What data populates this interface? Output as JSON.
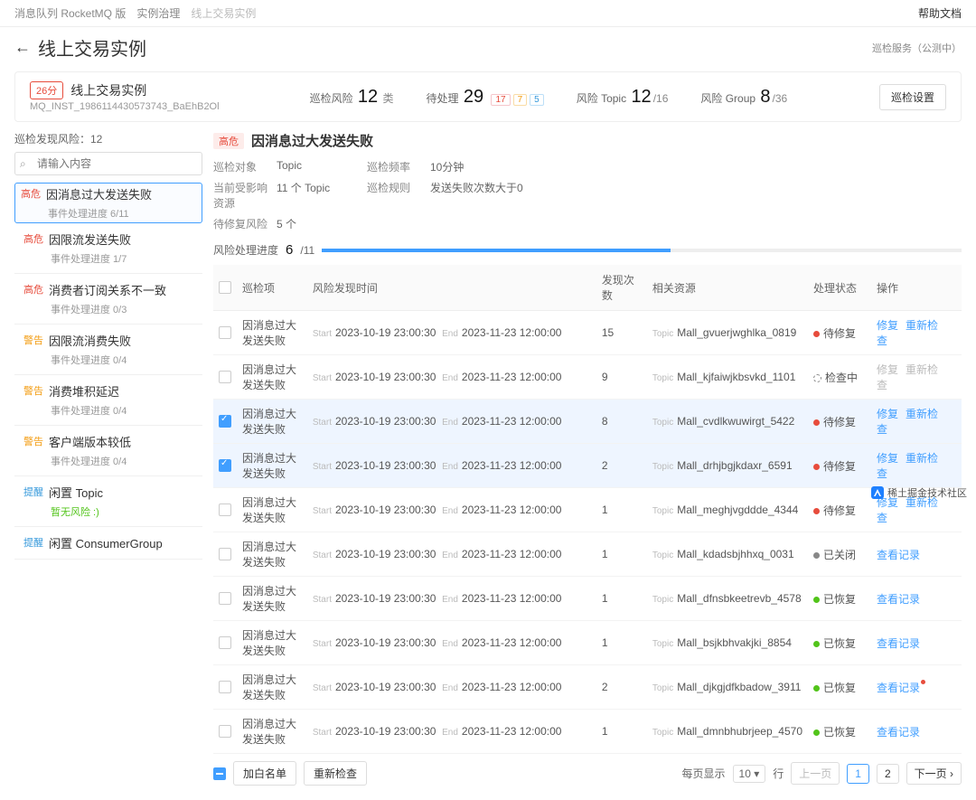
{
  "breadcrumb": {
    "a": "消息队列 RocketMQ 版",
    "b": "实例治理",
    "c": "线上交易实例"
  },
  "help": "帮助文档",
  "title": "线上交易实例",
  "subtag": "巡检服务（公测中）",
  "inst": {
    "score": "26分",
    "name": "线上交易实例",
    "id": "MQ_INST_1986114430573743_BaEhB2Ol"
  },
  "stats": {
    "risk_label": "巡检风险",
    "risk_n": "12",
    "risk_u": "类",
    "pend_label": "待处理",
    "pend_n": "29",
    "t1": "17",
    "t2": "7",
    "t3": "5",
    "topic_label": "风险 Topic",
    "topic_a": "12",
    "topic_b": "/16",
    "group_label": "风险 Group",
    "group_a": "8",
    "group_b": "/36",
    "btn": "巡检设置"
  },
  "left": {
    "cap": "巡检发现风险：12",
    "ph": "请输入内容",
    "items": [
      {
        "lvl": "高危",
        "cls": "high",
        "title": "因消息过大发送失败",
        "sub": "事件处理进度 6/11",
        "sel": true
      },
      {
        "lvl": "高危",
        "cls": "high",
        "title": "因限流发送失败",
        "sub": "事件处理进度 1/7"
      },
      {
        "lvl": "高危",
        "cls": "high",
        "title": "消费者订阅关系不一致",
        "sub": "事件处理进度 0/3"
      },
      {
        "lvl": "警告",
        "cls": "warn",
        "title": "因限流消费失败",
        "sub": "事件处理进度 0/4"
      },
      {
        "lvl": "警告",
        "cls": "warn",
        "title": "消费堆积延迟",
        "sub": "事件处理进度 0/4"
      },
      {
        "lvl": "警告",
        "cls": "warn",
        "title": "客户端版本较低",
        "sub": "事件处理进度 0/4"
      },
      {
        "lvl": "提醒",
        "cls": "tip",
        "title": "闲置 Topic",
        "norisk": "暂无风险 :)"
      },
      {
        "lvl": "提醒",
        "cls": "tip",
        "title": "闲置 ConsumerGroup"
      }
    ]
  },
  "detail": {
    "badge": "高危",
    "title": "因消息过大发送失败",
    "meta": {
      "k1": "巡检对象",
      "v1": "Topic",
      "k2": "巡检频率",
      "v2": "10分钟",
      "k3": "当前受影响资源",
      "v3": "11 个 Topic",
      "k4": "巡检规则",
      "v4": "发送失败次数大于0",
      "k5": "待修复风险",
      "v5": "5 个"
    },
    "prog_label": "风险处理进度",
    "prog_val": "6",
    "prog_tot": "/11",
    "prog_pct": 54.5
  },
  "table": {
    "h1": "巡检项",
    "h2": "风险发现时间",
    "h3": "发现次数",
    "h4": "相关资源",
    "h5": "处理状态",
    "h6": "操作",
    "start": "Start",
    "end": "End",
    "topic": "Topic",
    "a_fix": "修复",
    "a_re": "重新检查",
    "a_log": "查看记录",
    "st_fix": "待修复",
    "st_chk": "检查中",
    "st_closed": "已关闭",
    "st_done": "已恢复",
    "rows": [
      {
        "item": "因消息过大发送失败",
        "s": "2023-10-19 23:00:30",
        "e": "2023-11-23 12:00:00",
        "cnt": "15",
        "res": "Mall_gvuerjwghlka_0819",
        "st": "fix"
      },
      {
        "item": "因消息过大发送失败",
        "s": "2023-10-19 23:00:30",
        "e": "2023-11-23 12:00:00",
        "cnt": "9",
        "res": "Mall_kjfaiwjkbsvkd_1101",
        "st": "chk"
      },
      {
        "item": "因消息过大发送失败",
        "s": "2023-10-19 23:00:30",
        "e": "2023-11-23 12:00:00",
        "cnt": "8",
        "res": "Mall_cvdlkwuwirgt_5422",
        "st": "fix",
        "ck": true
      },
      {
        "item": "因消息过大发送失败",
        "s": "2023-10-19 23:00:30",
        "e": "2023-11-23 12:00:00",
        "cnt": "2",
        "res": "Mall_drhjbgjkdaxr_6591",
        "st": "fix",
        "ck": true
      },
      {
        "item": "因消息过大发送失败",
        "s": "2023-10-19 23:00:30",
        "e": "2023-11-23 12:00:00",
        "cnt": "1",
        "res": "Mall_meghjvgddde_4344",
        "st": "fix"
      },
      {
        "item": "因消息过大发送失败",
        "s": "2023-10-19 23:00:30",
        "e": "2023-11-23 12:00:00",
        "cnt": "1",
        "res": "Mall_kdadsbjhhxq_0031",
        "st": "closed"
      },
      {
        "item": "因消息过大发送失败",
        "s": "2023-10-19 23:00:30",
        "e": "2023-11-23 12:00:00",
        "cnt": "1",
        "res": "Mall_dfnsbkeetrevb_4578",
        "st": "done"
      },
      {
        "item": "因消息过大发送失败",
        "s": "2023-10-19 23:00:30",
        "e": "2023-11-23 12:00:00",
        "cnt": "1",
        "res": "Mall_bsjkbhvakjki_8854",
        "st": "done"
      },
      {
        "item": "因消息过大发送失败",
        "s": "2023-10-19 23:00:30",
        "e": "2023-11-23 12:00:00",
        "cnt": "2",
        "res": "Mall_djkgjdfkbadow_3911",
        "st": "done",
        "reddot": true
      },
      {
        "item": "因消息过大发送失败",
        "s": "2023-10-19 23:00:30",
        "e": "2023-11-23 12:00:00",
        "cnt": "1",
        "res": "Mall_dmnbhubrjeep_4570",
        "st": "done"
      }
    ]
  },
  "footer": {
    "btn1": "加白名单",
    "btn2": "重新检查",
    "pglabel": "每页显示",
    "pgsize": "10",
    "row": "行",
    "prev": "上一页",
    "p1": "1",
    "p2": "2",
    "next": "下一页"
  },
  "wm": "稀土掘金技术社区"
}
